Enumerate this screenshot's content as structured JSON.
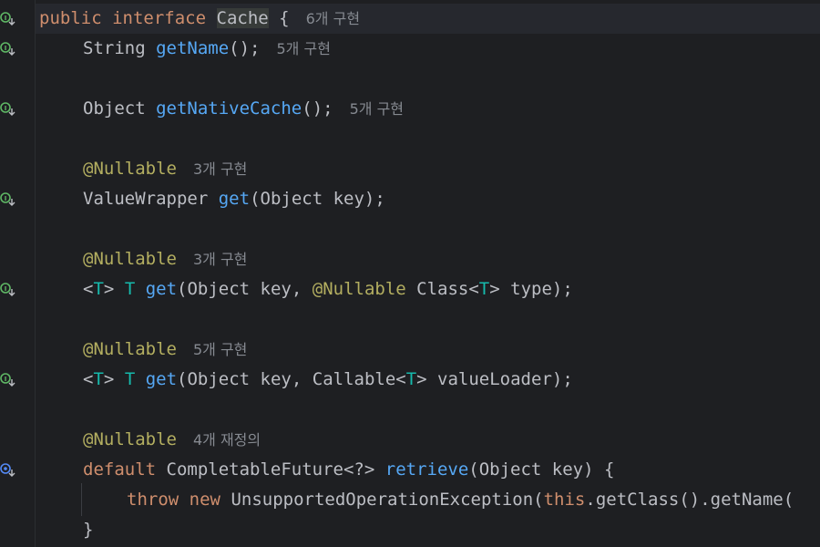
{
  "code": {
    "line1": {
      "kw_public": "public",
      "kw_interface": "interface",
      "class_name": "Cache",
      "brace": "{",
      "hint": "6개 구현"
    },
    "line2": {
      "type": "String",
      "method": "getName",
      "rest": "();",
      "hint": "5개 구현"
    },
    "line3": {
      "type": "Object",
      "method": "getNativeCache",
      "rest": "();",
      "hint": "5개 구현"
    },
    "line4": {
      "annotation": "@Nullable",
      "hint": "3개 구현"
    },
    "line5": {
      "type": "ValueWrapper",
      "method": "get",
      "rest": "(Object key);"
    },
    "line6": {
      "annotation": "@Nullable",
      "hint": "3개 구현"
    },
    "line7": {
      "lt": "<",
      "tparam": "T",
      "gt": ">",
      "ret": "T",
      "method": "get",
      "args_a": "(Object key, ",
      "inner_annotation": "@Nullable",
      "args_b": " Class<",
      "tparam2": "T",
      "args_c": "> type);"
    },
    "line8": {
      "annotation": "@Nullable",
      "hint": "5개 구현"
    },
    "line9": {
      "lt": "<",
      "tparam": "T",
      "gt": ">",
      "ret": "T",
      "method": "get",
      "args_a": "(Object key, Callable<",
      "tparam2": "T",
      "args_c": "> valueLoader);"
    },
    "line10": {
      "annotation": "@Nullable",
      "hint": "4개 재정의"
    },
    "line11": {
      "kw_default": "default",
      "type": "CompletableFuture<?>",
      "method": "retrieve",
      "rest": "(Object key) {"
    },
    "line12": {
      "kw_throw": "throw",
      "kw_new": "new",
      "exc": "UnsupportedOperationException(",
      "kw_this": "this",
      "rest": ".getClass().getName("
    },
    "line13": {
      "brace": "}"
    }
  },
  "gutter_icons": {
    "implemented": "implemented-marker-icon",
    "overridden": "overridden-marker-icon"
  },
  "colors": {
    "background": "#1e1f22",
    "keyword": "#cf8e6d",
    "function": "#56a8f5",
    "annotation": "#b3ae60",
    "type_param": "#16baac",
    "text": "#bcbec4",
    "hint": "#868a91",
    "icon_green": "#5fb865",
    "icon_blue": "#548af7"
  }
}
